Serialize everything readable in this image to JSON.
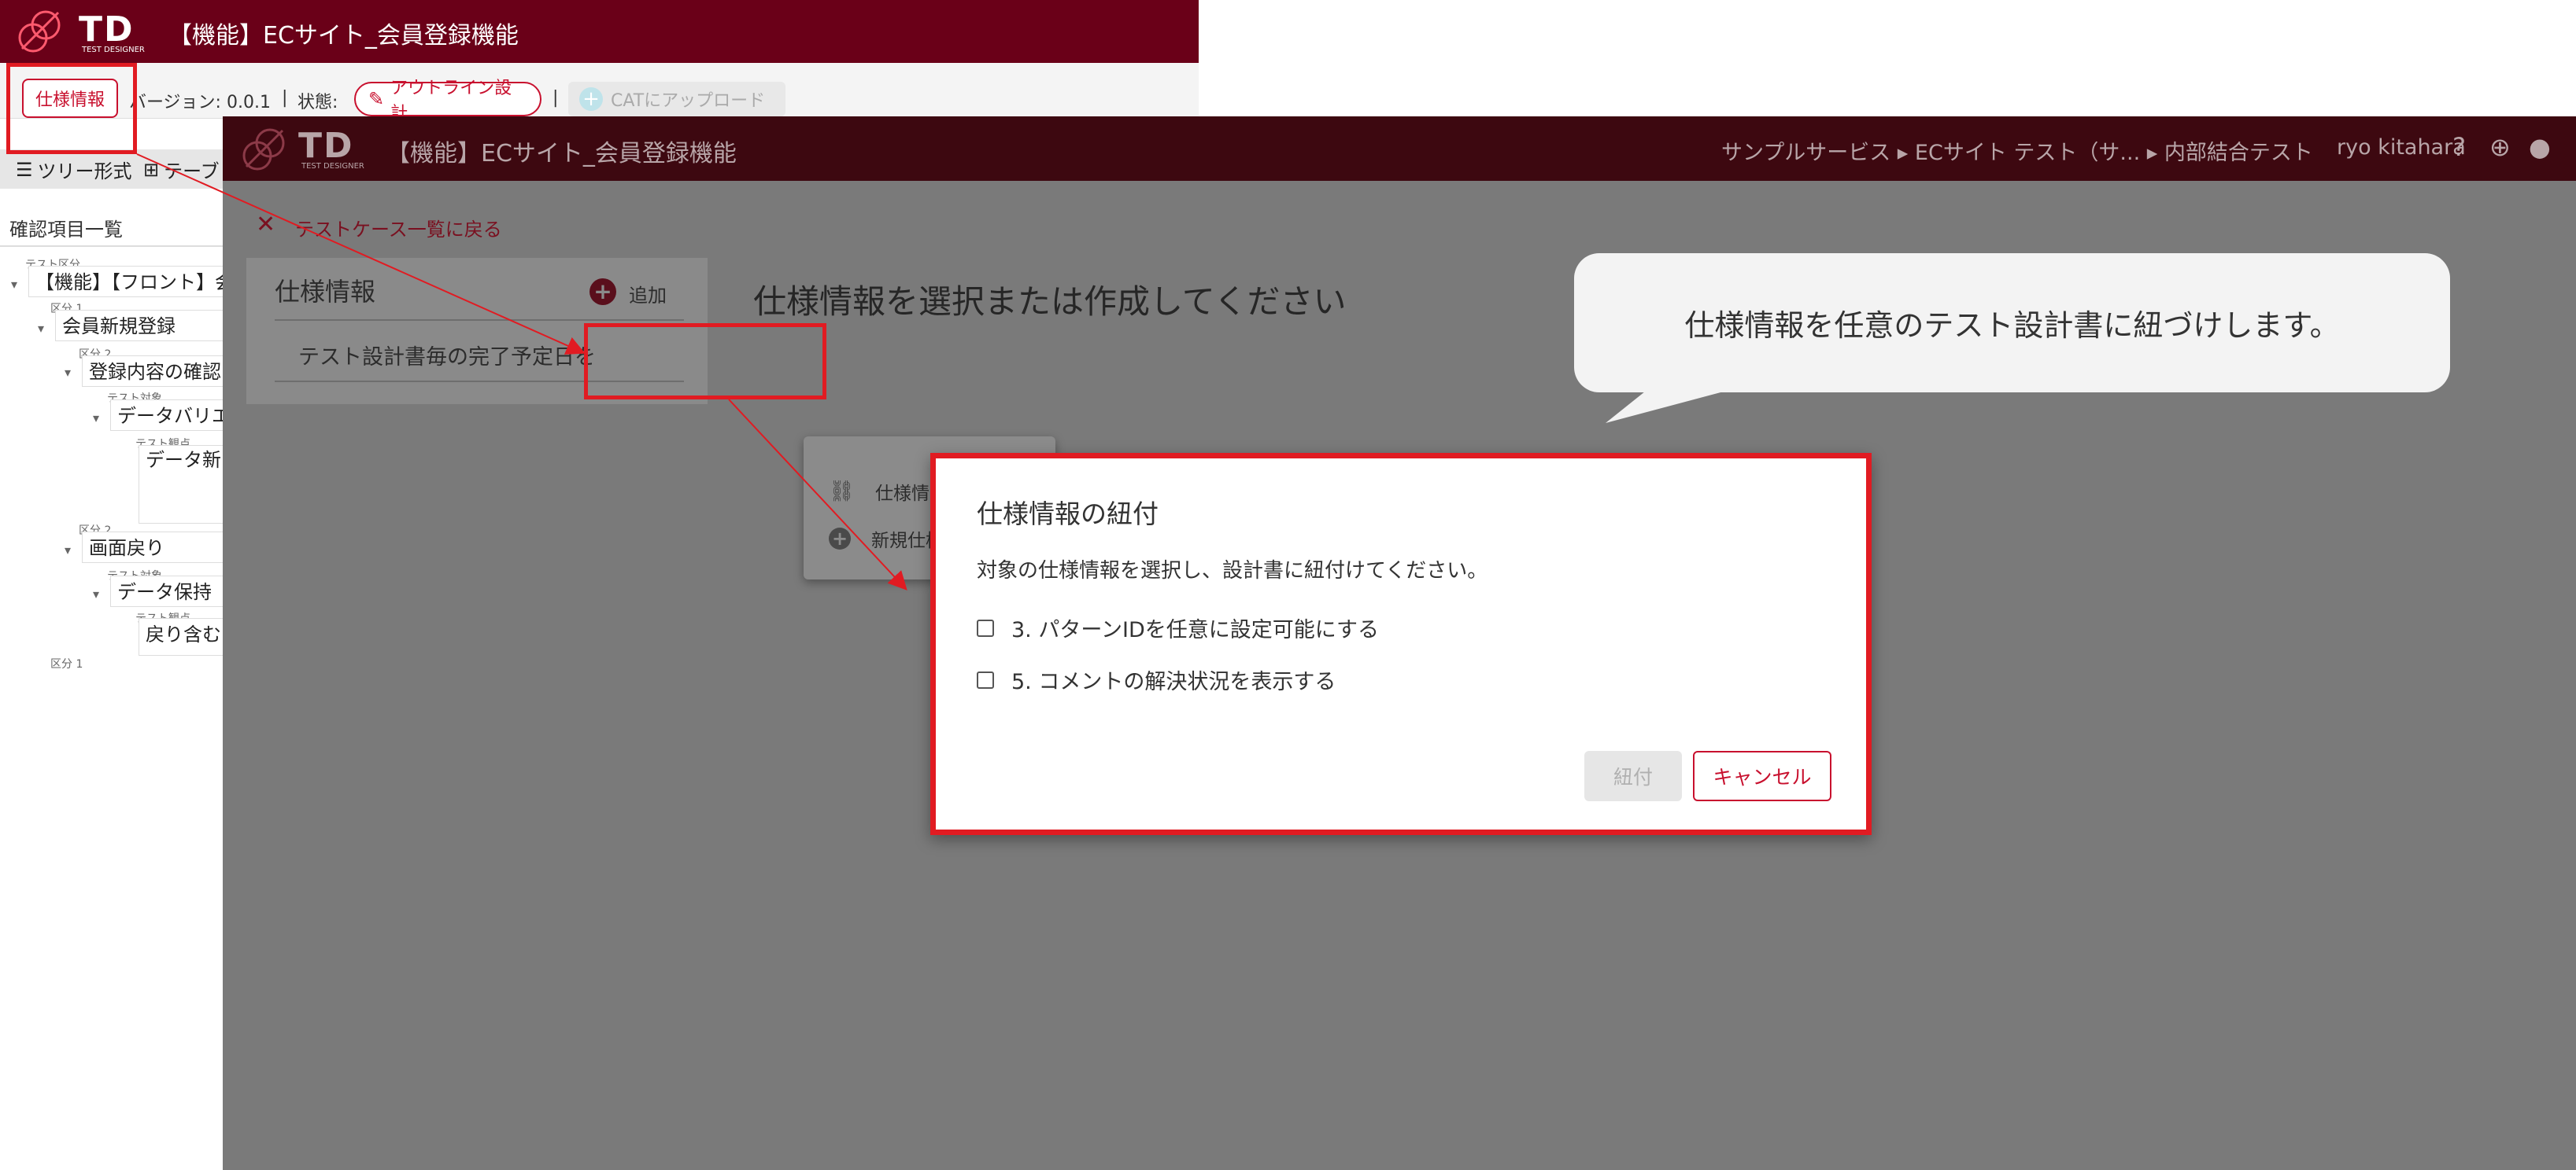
{
  "app": {
    "brand": "TD",
    "brand_sub": "TEST DESIGNER",
    "title": "【機能】ECサイト_会員登録機能"
  },
  "toolbar": {
    "spec_button": "仕様情報",
    "version": "バージョン: 0.0.1",
    "separator": "|",
    "status_label": "状態:",
    "status_value": "アウトライン設計",
    "cat_upload": "CATにアップロード"
  },
  "view_tabs": {
    "tree": "ツリー形式",
    "table": "テーブ"
  },
  "tree": {
    "heading": "確認項目一覧",
    "nodes": [
      {
        "small": "テスト区分",
        "label": "【機能】【フロント】会"
      },
      {
        "small": "区分 1",
        "label": "会員新規登録"
      },
      {
        "small": "区分 2",
        "label": "登録内容の確認"
      },
      {
        "small": "テスト対象",
        "label": "データバリエ"
      },
      {
        "small": "テスト観点",
        "label": "データ新"
      },
      {
        "small": "区分 2",
        "label": "画面戻り"
      },
      {
        "small": "テスト対象",
        "label": "データ保持"
      },
      {
        "small": "テスト観点",
        "label": "戻り含む"
      },
      {
        "small": "区分 1",
        "label": ""
      }
    ]
  },
  "overlay_header": {
    "title": "【機能】ECサイト_会員登録機能",
    "breadcrumb": "サンプルサービス ▸ ECサイト テスト（サ... ▸ 内部結合テスト",
    "user": "ryo kitahara"
  },
  "back_link": "テストケース一覧に戻る",
  "spec_panel": {
    "heading": "仕様情報",
    "add_label": "追加",
    "item": "テスト設計書毎の完了予定日を"
  },
  "menu": {
    "link_spec": "仕様情報の紐付",
    "new_spec": "新規仕様情報作成"
  },
  "main_prompt": "仕様情報を選択または作成してください",
  "callout": "仕様情報を任意のテスト設計書に紐づけします。",
  "dialog": {
    "title": "仕様情報の紐付",
    "description": "対象の仕様情報を選択し、設計書に紐付けてください。",
    "options": [
      "3. パターンIDを任意に設定可能にする",
      "5. コメントの解決状況を表示する"
    ],
    "confirm": "紐付",
    "cancel": "キャンセル"
  },
  "colors": {
    "brand_dark": "#6a0018",
    "accent": "#c8102e",
    "annotation_red": "#e11b22"
  }
}
